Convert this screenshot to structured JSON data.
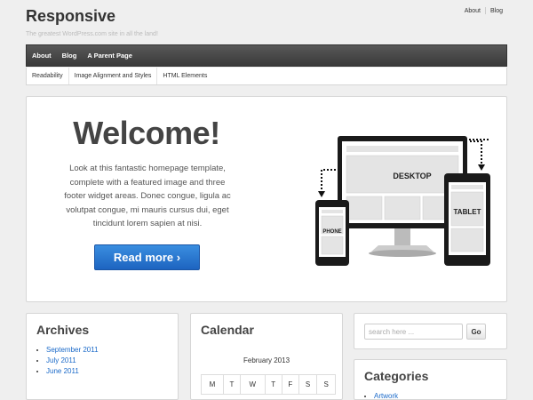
{
  "header": {
    "site_title": "Responsive",
    "tagline": "The greatest WordPress.com site in all the land!",
    "top_links": [
      "About",
      "Blog"
    ]
  },
  "main_nav": [
    "About",
    "Blog",
    "A Parent Page"
  ],
  "sub_nav": [
    "Readability",
    "Image Alignment and Styles",
    "HTML Elements"
  ],
  "hero": {
    "title": "Welcome!",
    "text": "Look at this fantastic homepage template, complete with a featured image and three footer widget areas. Donec congue, ligula ac volutpat congue, mi mauris cursus dui, eget tincidunt lorem sapien at nisi.",
    "button_label": "Read more ›",
    "devices": {
      "desktop": "DESKTOP",
      "tablet": "TABLET",
      "phone": "PHONE"
    }
  },
  "archives": {
    "title": "Archives",
    "items": [
      "September 2011",
      "July 2011",
      "June 2011"
    ]
  },
  "calendar": {
    "title": "Calendar",
    "caption": "February 2013",
    "days": [
      "M",
      "T",
      "W",
      "T",
      "F",
      "S",
      "S"
    ]
  },
  "search": {
    "placeholder": "search here ...",
    "button_label": "Go"
  },
  "categories": {
    "title": "Categories",
    "items": [
      "Artwork"
    ]
  },
  "colors": {
    "link": "#1b6ac9",
    "nav": "#444444",
    "button": "#2a7ad6"
  }
}
